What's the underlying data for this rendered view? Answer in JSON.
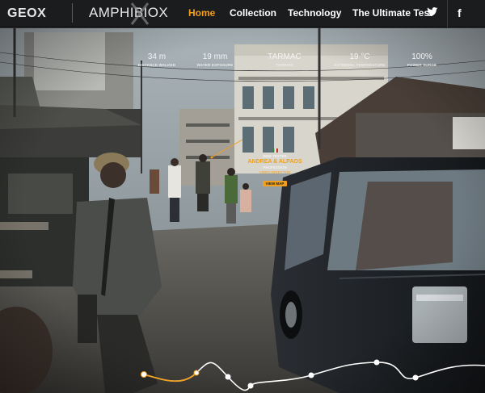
{
  "header": {
    "brand": "GEOX",
    "product": "AMPHIBIOX",
    "nav": [
      {
        "label": "Home",
        "active": true
      },
      {
        "label": "Collection",
        "active": false
      },
      {
        "label": "Technology",
        "active": false
      },
      {
        "label": "The Ultimate Test",
        "active": false
      }
    ],
    "social": {
      "twitter_icon": "twitter-bird-icon",
      "facebook_label": "f"
    },
    "accent_color": "#f0a01e"
  },
  "stats": [
    {
      "value": "34 m",
      "label": "DISTANCE WALKED"
    },
    {
      "value": "19 mm",
      "label": "WATER EXPOSURE"
    },
    {
      "value": "TARMAC",
      "label": "TERRAIN"
    },
    {
      "value": "19 °C",
      "label": "EXTERNAL TEMPERATURE"
    },
    {
      "value": "100%",
      "label": "POWER SURGE"
    }
  ],
  "street_tag": {
    "line1": "WEB TESTER",
    "name": "ANDREA & ALPAOS",
    "line3": "PROFESSION",
    "line4": "VIDEO DIRECTOR",
    "button": "VIEW MAP"
  },
  "route": {
    "progress": 0.12,
    "waypoint_count": 8
  }
}
